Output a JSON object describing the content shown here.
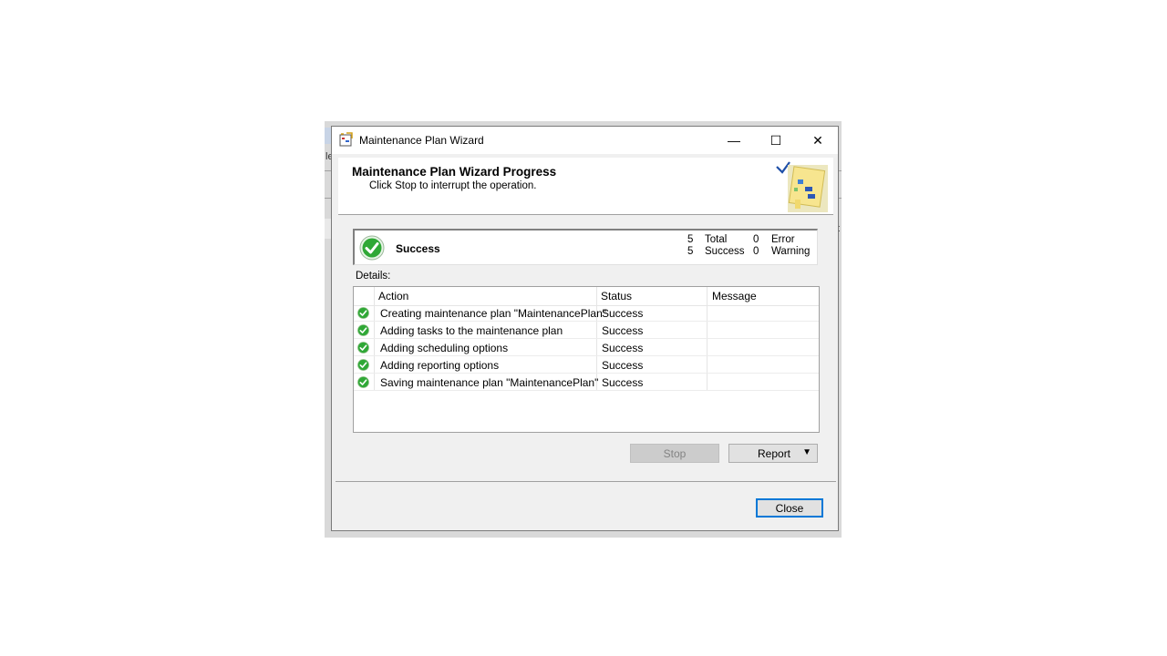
{
  "window": {
    "title": "Maintenance Plan Wizard",
    "controls": {
      "minimize": "—",
      "maximize": "☐",
      "close": "✕"
    }
  },
  "header": {
    "title": "Maintenance Plan Wizard Progress",
    "subtitle": "Click Stop to interrupt the operation."
  },
  "summary": {
    "status": "Success",
    "total_count": "5",
    "total_label": "Total",
    "success_count": "5",
    "success_label": "Success",
    "error_count": "0",
    "error_label": "Error",
    "warning_count": "0",
    "warning_label": "Warning"
  },
  "details": {
    "label": "Details:",
    "columns": [
      "Action",
      "Status",
      "Message"
    ],
    "rows": [
      {
        "action": "Creating maintenance plan \"MaintenancePlan\"",
        "status": "Success",
        "message": ""
      },
      {
        "action": "Adding tasks to the maintenance plan",
        "status": "Success",
        "message": ""
      },
      {
        "action": "Adding scheduling options",
        "status": "Success",
        "message": ""
      },
      {
        "action": "Adding reporting options",
        "status": "Success",
        "message": ""
      },
      {
        "action": "Saving maintenance plan \"MaintenancePlan\"",
        "status": "Success",
        "message": ""
      }
    ]
  },
  "buttons": {
    "stop": "Stop",
    "report": "Report",
    "report_arrow": "▼",
    "close": "Close"
  },
  "background": {
    "partial_letter_left": "le",
    "partial_letter_right": "t"
  },
  "colors": {
    "success_green": "#2fa836",
    "focus_border": "#0078d7"
  }
}
